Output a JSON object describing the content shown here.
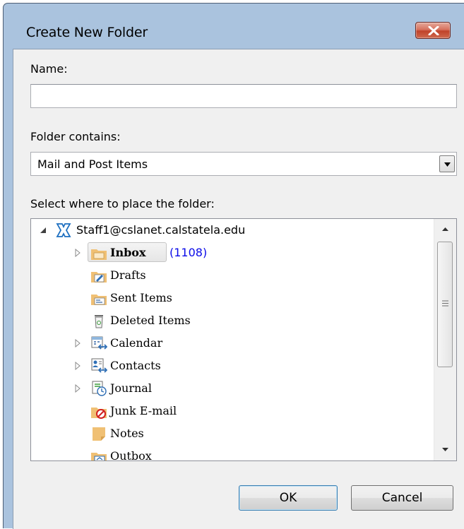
{
  "window": {
    "title": "Create New Folder"
  },
  "form": {
    "name_label": "Name:",
    "name_value": "",
    "contains_label": "Folder contains:",
    "contains_value": "Mail and Post Items",
    "place_label": "Select where to place the folder:"
  },
  "tree": {
    "account": "Staff1@cslanet.calstatela.edu",
    "items": [
      {
        "label": "Inbox",
        "count": "(1108)",
        "icon": "inbox-folder-icon",
        "expandable": true,
        "selected": true
      },
      {
        "label": "Drafts",
        "icon": "drafts-folder-icon",
        "expandable": false
      },
      {
        "label": "Sent Items",
        "icon": "sent-items-folder-icon",
        "expandable": false
      },
      {
        "label": "Deleted Items",
        "icon": "trash-can-icon",
        "expandable": false
      },
      {
        "label": "Calendar",
        "icon": "calendar-folder-icon",
        "expandable": true
      },
      {
        "label": "Contacts",
        "icon": "contacts-folder-icon",
        "expandable": true
      },
      {
        "label": "Journal",
        "icon": "journal-folder-icon",
        "expandable": true
      },
      {
        "label": "Junk E-mail",
        "icon": "junk-email-folder-icon",
        "expandable": false
      },
      {
        "label": "Notes",
        "icon": "notes-folder-icon",
        "expandable": false
      },
      {
        "label": "Outbox",
        "icon": "outbox-folder-icon",
        "expandable": false
      }
    ]
  },
  "buttons": {
    "ok": "OK",
    "cancel": "Cancel"
  },
  "colors": {
    "title_bar": "#aac3de",
    "close_button": "#c9553e",
    "count_text": "#0a0ae8",
    "dialog_body": "#f0f0f0"
  }
}
